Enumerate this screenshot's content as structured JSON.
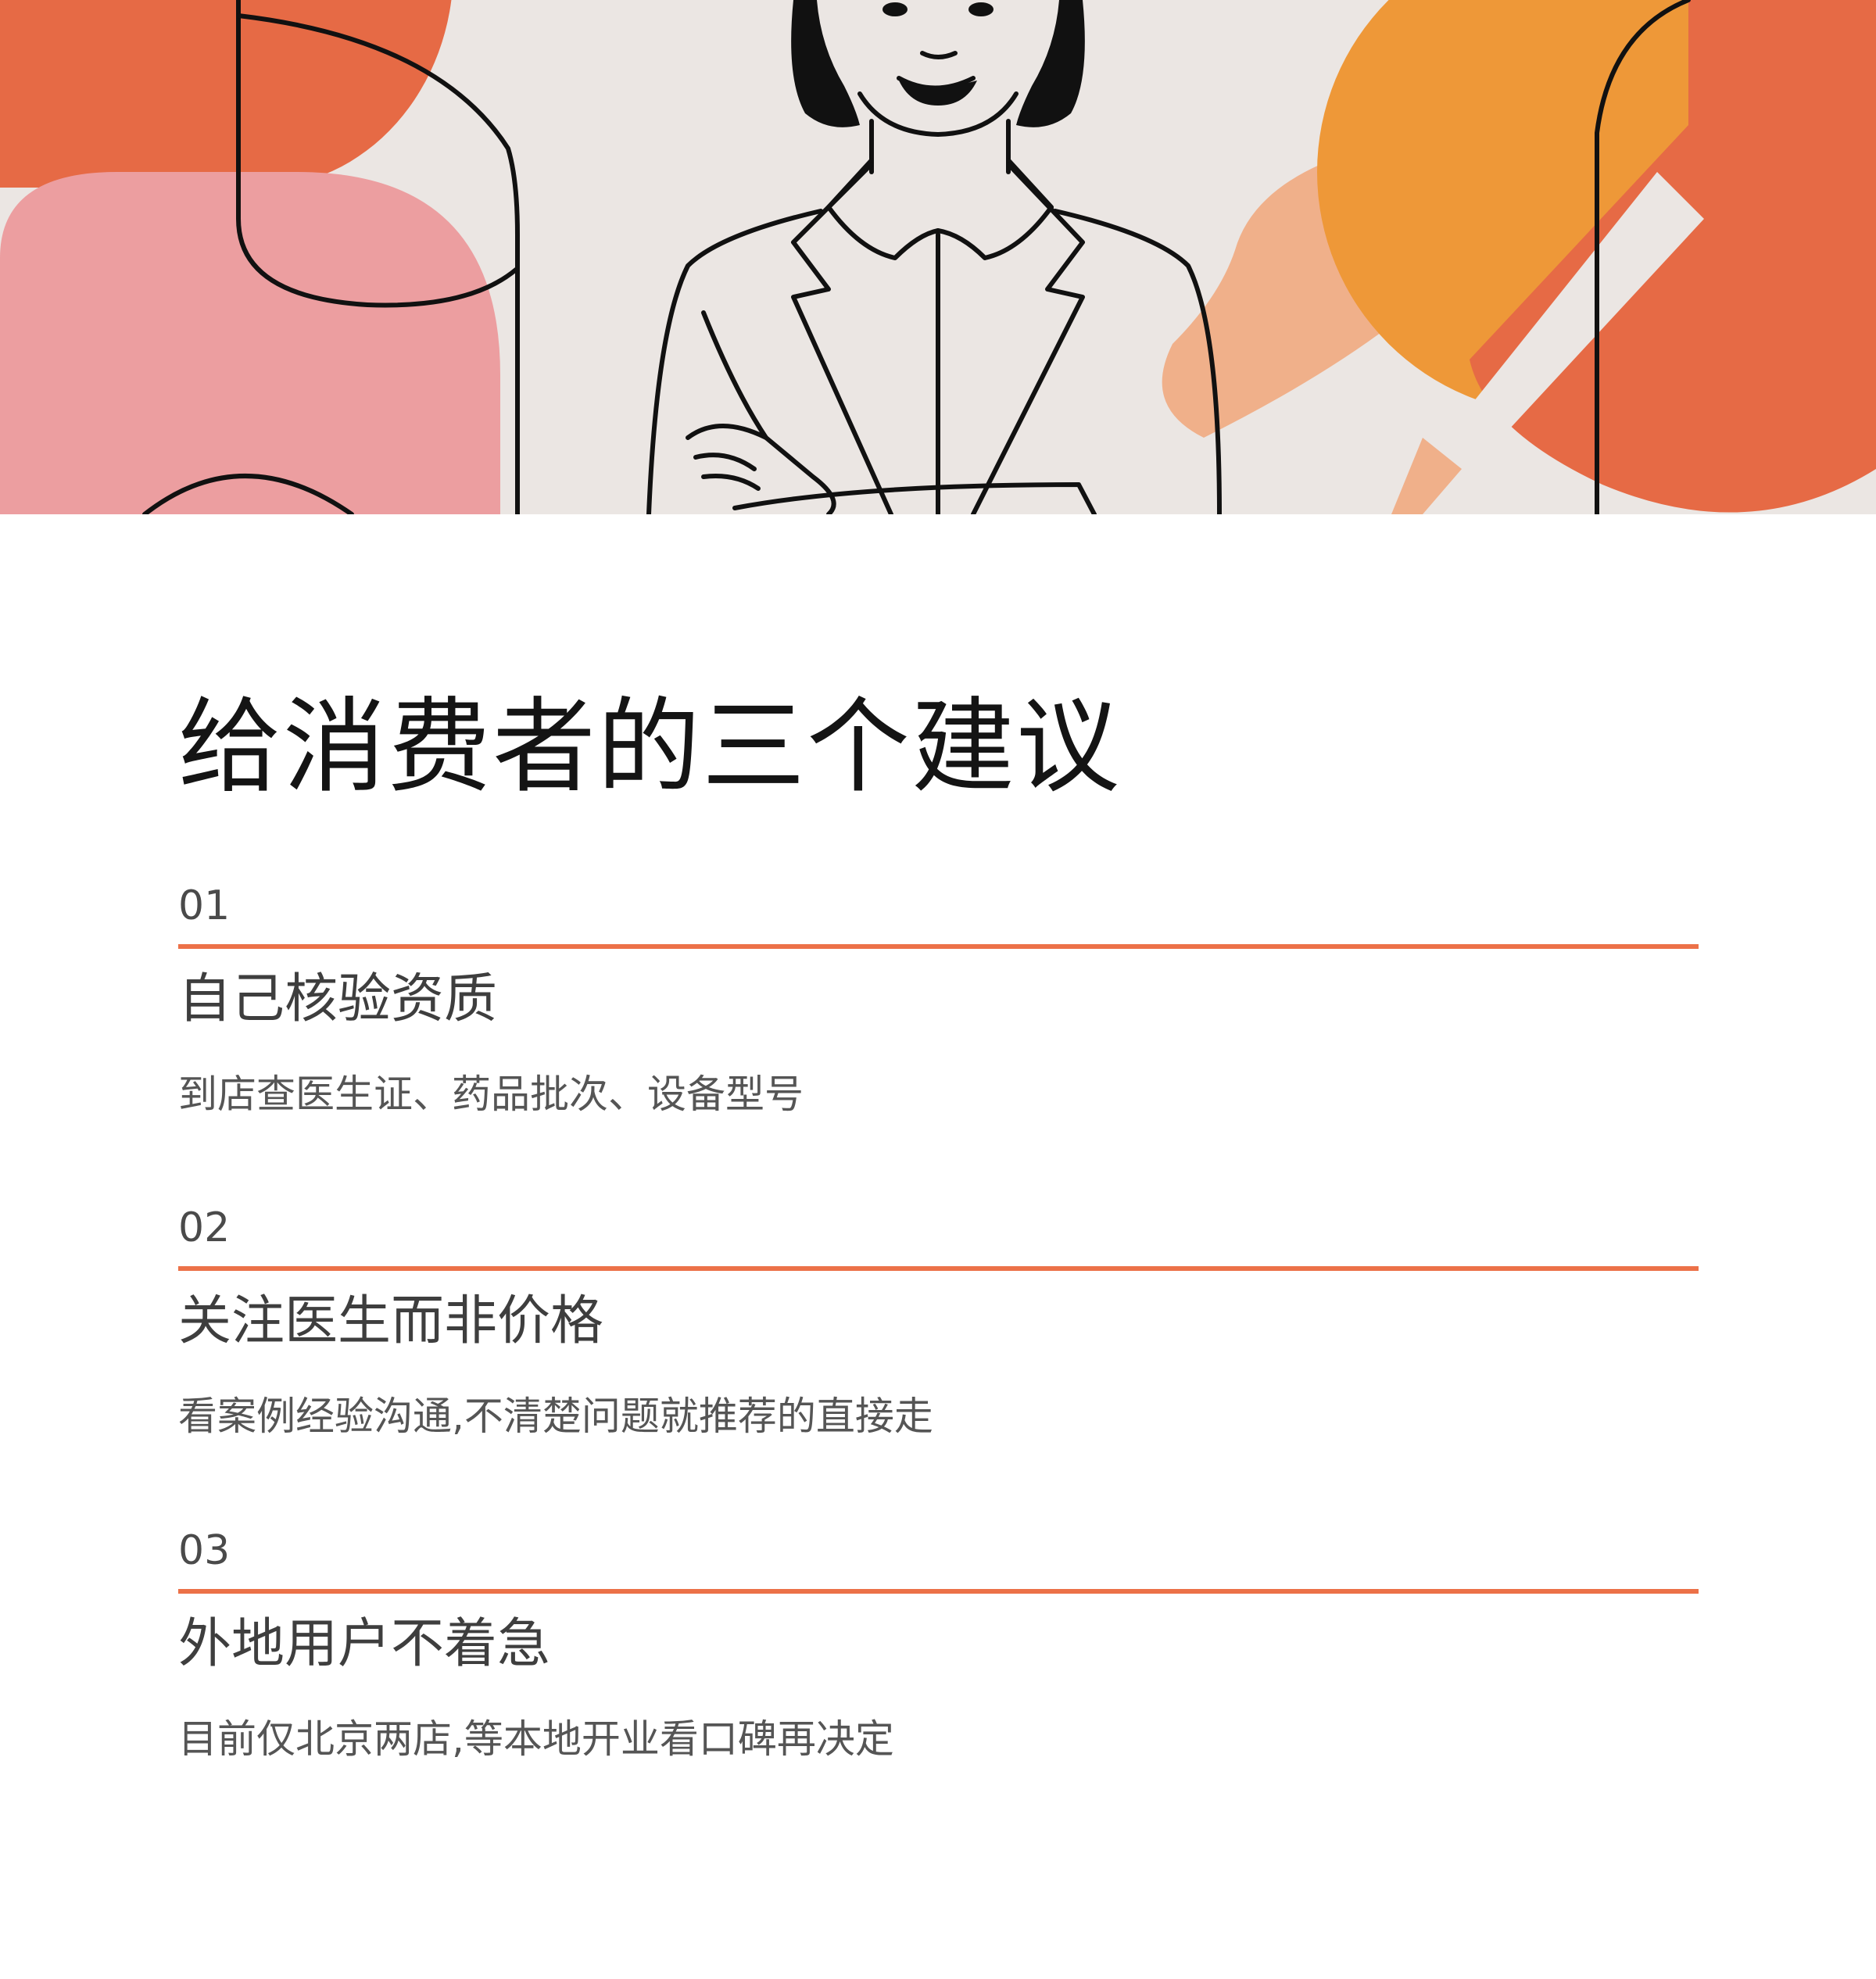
{
  "hero": {
    "illustration": "woman-in-blazer-arms-crossed-illustration",
    "colors": {
      "background": "#ebe6e3",
      "coral": "#e66a45",
      "pink": "#ec9ea0",
      "peach": "#f0b08a",
      "orange": "#ee9838",
      "line": "#111111"
    }
  },
  "title": "给消费者的三个建议",
  "accent_color": "#ec7148",
  "tips": [
    {
      "number": "01",
      "heading": "自己核验资质",
      "description": "到店查医生证、药品批次、设备型号"
    },
    {
      "number": "02",
      "heading": "关注医生而非价格",
      "description": "看案例经验沟通,不清楚问题就推荐的直接走"
    },
    {
      "number": "03",
      "heading": "外地用户不着急",
      "description": "目前仅北京两店,等本地开业看口碑再决定"
    }
  ]
}
